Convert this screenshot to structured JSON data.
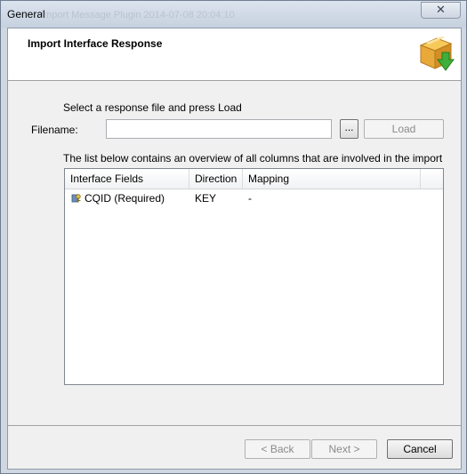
{
  "window": {
    "title": "General",
    "background_title": "Import Message Plugin  2014-07-08 20:04:10",
    "close_label": "✕"
  },
  "header": {
    "title": "Import Interface Response",
    "icon": "package-import-icon"
  },
  "form": {
    "instruction": "Select a response file and press Load",
    "filename_label": "Filename:",
    "filename_value": "",
    "browse_label": "...",
    "load_label": "Load"
  },
  "list": {
    "description": "The list below contains an overview of all columns that are involved in the import operatio",
    "columns": [
      "Interface Fields",
      "Direction",
      "Mapping"
    ],
    "rows": [
      {
        "icon": "key-icon",
        "field": "CQID (Required)",
        "direction": "KEY",
        "mapping": "-"
      }
    ]
  },
  "footer": {
    "back_label": "< Back",
    "next_label": "Next >",
    "cancel_label": "Cancel"
  },
  "colors": {
    "frame": "#cfd7e2",
    "client": "#f0f0f0",
    "disabled_text": "#8a8a8a",
    "icon_box": "#e8a93a",
    "icon_arrow": "#3fae3a"
  }
}
